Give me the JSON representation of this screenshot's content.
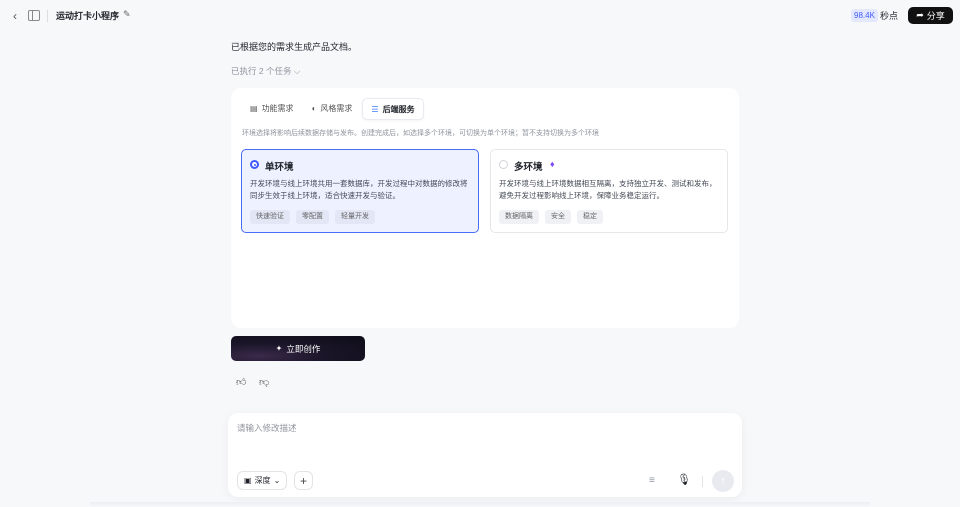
{
  "topbar": {
    "title": "运动打卡小程序",
    "usage_count": "98.4K",
    "brand": "秒点",
    "share_label": "分享"
  },
  "chat": {
    "message": "已根据您的需求生成产品文档。",
    "executed": "已执行 2 个任务"
  },
  "card": {
    "tabs": [
      {
        "label": "功能需求",
        "icon": "document-icon",
        "active": false
      },
      {
        "label": "风格需求",
        "icon": "palette-icon",
        "active": false
      },
      {
        "label": "后端服务",
        "icon": "database-icon",
        "active": true
      }
    ],
    "hint": "环境选择将影响后续数据存储与发布。创建完成后，如选择多个环境，可切换为单个环境；暂不支持切换为多个环境",
    "options": [
      {
        "title": "单环境",
        "selected": true,
        "description": "开发环境与线上环境共用一套数据库，开发过程中对数据的修改将同步生效于线上环境，适合快速开发与验证。",
        "tags": [
          "快速验证",
          "零配置",
          "轻量开发"
        ]
      },
      {
        "title": "多环境",
        "selected": false,
        "premium_icon": "diamond-icon",
        "description": "开发环境与线上环境数据相互隔离，支持独立开发、测试和发布，避免开发过程影响线上环境，保障业务稳定运行。",
        "tags": [
          "数据隔离",
          "安全",
          "稳定"
        ]
      }
    ]
  },
  "create_button": "立即创作",
  "input": {
    "placeholder": "请输入修改描述",
    "mode_label": "深度"
  },
  "colors": {
    "accent": "#3d5afe",
    "premium": "#7b4cf5",
    "background": "#f7f8fa"
  }
}
